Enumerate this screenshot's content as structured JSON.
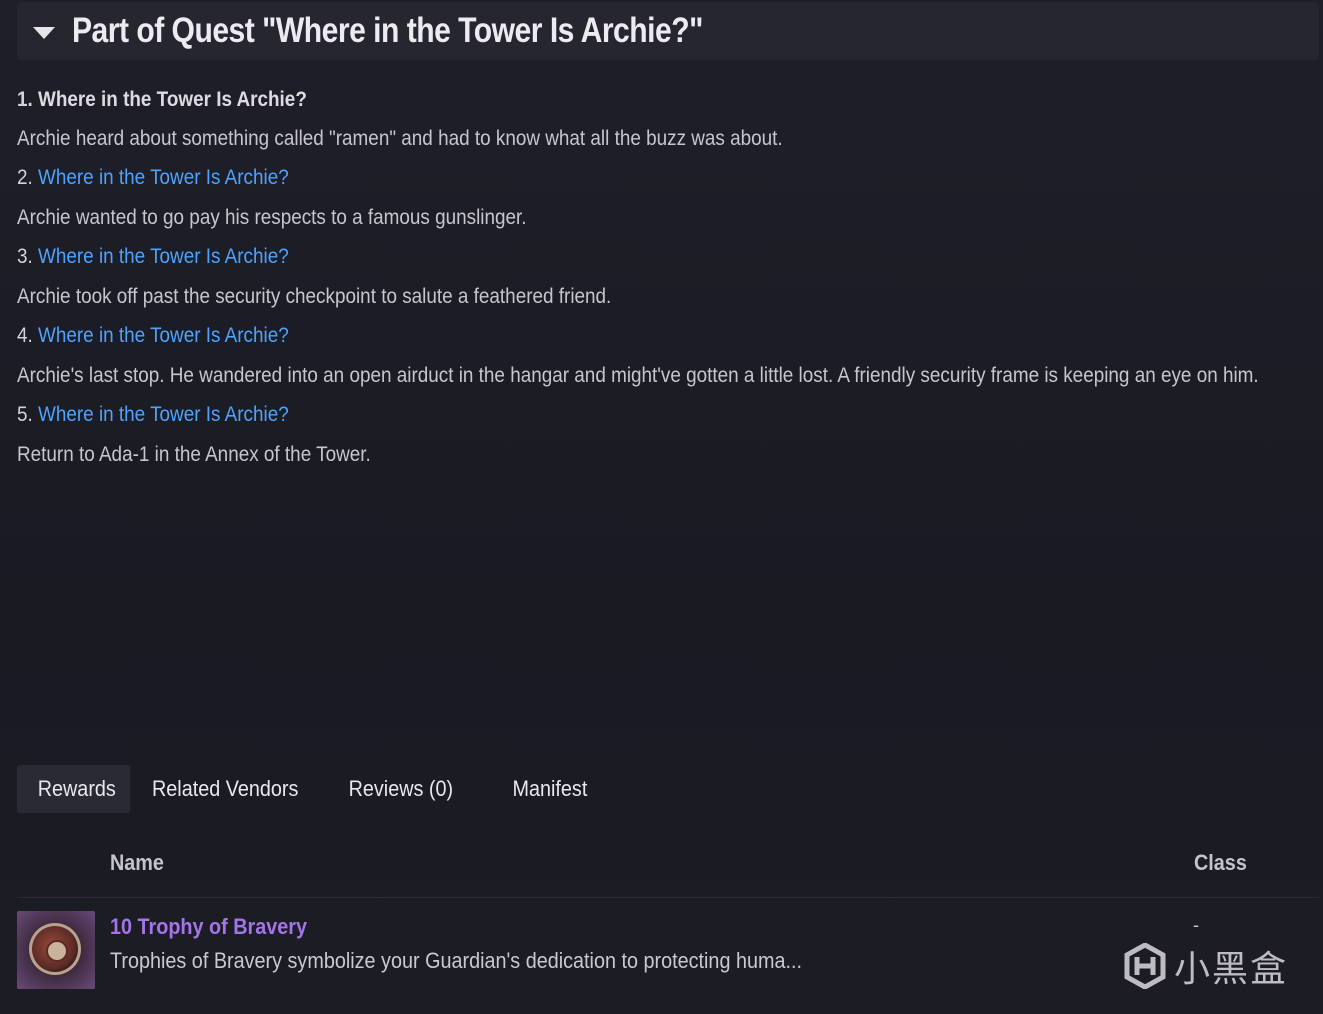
{
  "quest_header": {
    "title": "Part of Quest \"Where in the Tower Is Archie?\""
  },
  "steps": [
    {
      "num": "1. ",
      "title": "Where in the Tower Is Archie?",
      "description": "Archie heard about something called \"ramen\" and had to know what all the buzz was about."
    },
    {
      "num": "2. ",
      "title": "Where in the Tower Is Archie?",
      "description": "Archie wanted to go pay his respects to a famous gunslinger."
    },
    {
      "num": "3. ",
      "title": "Where in the Tower Is Archie?",
      "description": "Archie took off past the security checkpoint to salute a feathered friend."
    },
    {
      "num": "4. ",
      "title": "Where in the Tower Is Archie?",
      "description": "Archie's last stop. He wandered into an open airduct in the hangar and might've gotten a little lost. A friendly security frame is keeping an eye on him."
    },
    {
      "num": "5. ",
      "title": "Where in the Tower Is Archie?",
      "description": "Return to Ada-1 in the Annex of the Tower."
    }
  ],
  "tabs": [
    {
      "label": "Rewards",
      "active": true
    },
    {
      "label": "Related Vendors",
      "active": false
    },
    {
      "label": "Reviews (0)",
      "active": false
    },
    {
      "label": "Manifest",
      "active": false
    }
  ],
  "rewards_table": {
    "columns": {
      "name": "Name",
      "class": "Class"
    },
    "rows": [
      {
        "name": "10 Trophy of Bravery",
        "description": "Trophies of Bravery symbolize your Guardian's dedication to protecting huma...",
        "class": "-",
        "icon": "trophy-of-bravery-icon"
      }
    ]
  },
  "watermark": {
    "text": "小黑盒",
    "icon": "xiaoheihe-logo-icon"
  },
  "colors": {
    "link": "#4da3ff",
    "reward_name": "#a475e8",
    "background": "#1d1d26"
  }
}
